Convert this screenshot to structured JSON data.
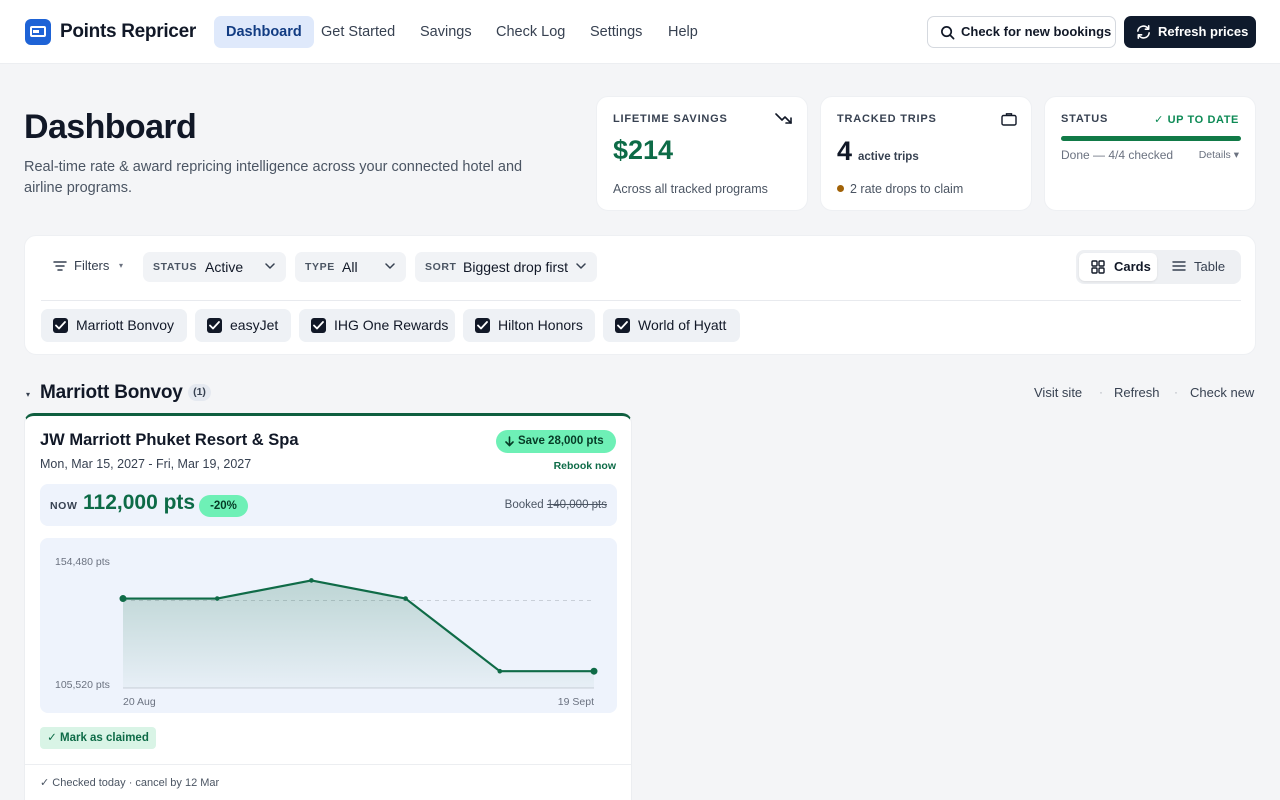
{
  "app": {
    "name": "Points Repricer"
  },
  "nav": {
    "items": [
      {
        "label": "Dashboard",
        "active": true
      },
      {
        "label": "Get Started",
        "active": false
      },
      {
        "label": "Savings",
        "active": false
      },
      {
        "label": "Check Log",
        "active": false
      },
      {
        "label": "Settings",
        "active": false
      },
      {
        "label": "Help",
        "active": false
      }
    ]
  },
  "actions": {
    "check_bookings": "Check for new bookings",
    "refresh_prices": "Refresh prices"
  },
  "hero": {
    "title": "Dashboard",
    "subtitle": "Real-time rate & award repricing intelligence across your connected hotel and airline programs."
  },
  "stats": {
    "lifetime": {
      "label": "LIFETIME SAVINGS",
      "value": "$214",
      "foot": "Across all tracked programs",
      "icon": "trending-down-icon"
    },
    "trips": {
      "label": "TRACKED TRIPS",
      "value": "4",
      "unit": "active trips",
      "note": "2 rate drops to claim",
      "icon": "briefcase-icon"
    },
    "status": {
      "label": "STATUS",
      "badge": "✓ UP TO DATE",
      "progress": 1.0,
      "text": "Done — 4/4 checked",
      "details": "Details ▾"
    }
  },
  "filters": {
    "label": "Filters",
    "status": {
      "key": "STATUS",
      "value": "Active"
    },
    "type": {
      "key": "TYPE",
      "value": "All"
    },
    "sort": {
      "key": "SORT",
      "value": "Biggest drop first"
    },
    "view": {
      "cards": "Cards",
      "table": "Table",
      "selected": "Cards"
    },
    "programs": [
      {
        "label": "Marriott Bonvoy",
        "checked": true
      },
      {
        "label": "easyJet",
        "checked": true
      },
      {
        "label": "IHG One Rewards",
        "checked": true
      },
      {
        "label": "Hilton Honors",
        "checked": true
      },
      {
        "label": "World of Hyatt",
        "checked": true
      }
    ]
  },
  "group": {
    "title": "Marriott Bonvoy",
    "count": "(1)",
    "links": {
      "visit": "Visit site",
      "refresh": "Refresh",
      "check": "Check new"
    }
  },
  "booking": {
    "hotel": "JW Marriott Phuket Resort & Spa",
    "dates": "Mon, Mar 15, 2027 - Fri, Mar 19, 2027",
    "save_badge": "Save 28,000 pts",
    "rebook": "Rebook now",
    "now_label": "NOW",
    "now_value": "112,000 pts",
    "pct": "-20%",
    "booked_label": "Booked",
    "booked_value": "140,000 pts",
    "claim": "✓ Mark as claimed",
    "checked": "✓ Checked today · cancel by 12 Mar"
  },
  "chart_data": {
    "type": "area",
    "y_labels": [
      "154,480 pts",
      "105,520 pts"
    ],
    "x_labels": [
      "20 Aug",
      "19 Sept"
    ],
    "ylim": [
      105520,
      154480
    ],
    "reference_line": 140000,
    "values": [
      140000,
      140000,
      147000,
      140000,
      112000,
      112000
    ],
    "color": "#0f6b47"
  },
  "colors": {
    "accent": "#1e63d6",
    "green": "#0d6b47",
    "mint": "#6ef0b6",
    "dark": "#0f1a2c"
  }
}
